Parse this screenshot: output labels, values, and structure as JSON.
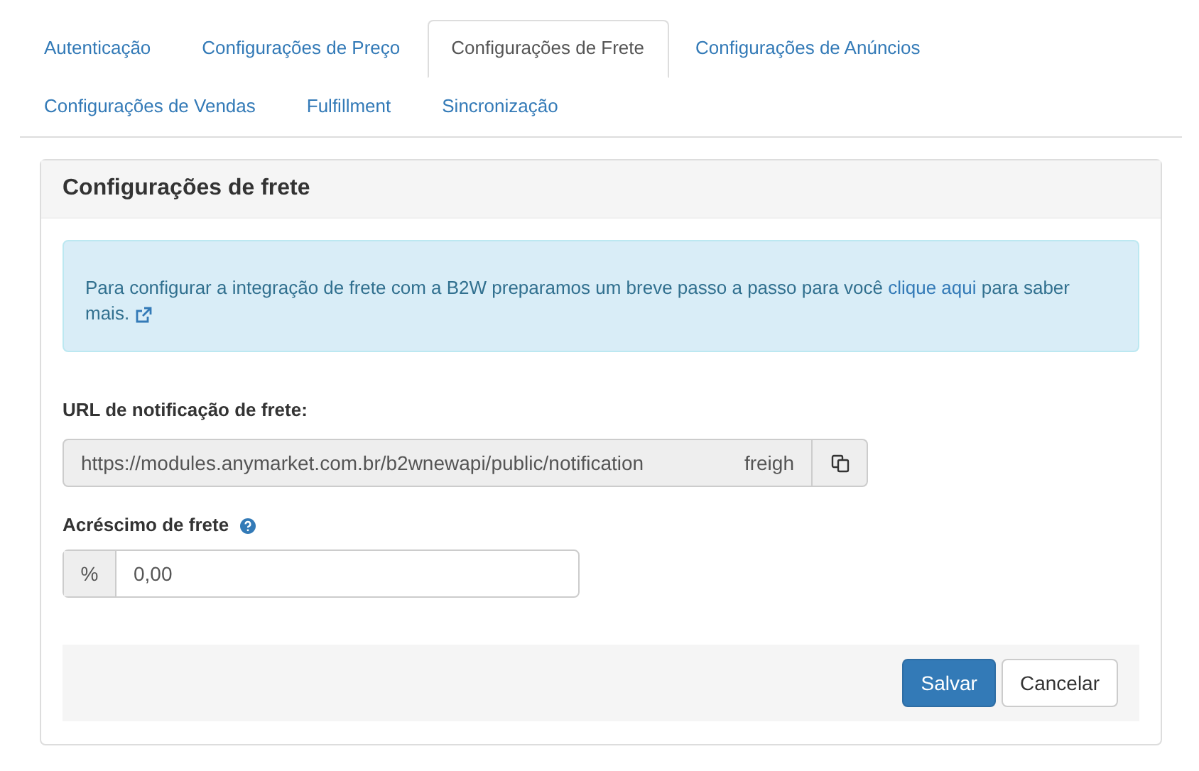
{
  "tabs": [
    {
      "label": "Autenticação",
      "selected": false
    },
    {
      "label": "Configurações de Preço",
      "selected": false
    },
    {
      "label": "Configurações de Frete",
      "selected": true
    },
    {
      "label": "Configurações de Anúncios",
      "selected": false
    },
    {
      "label": "Configurações de Vendas",
      "selected": false
    },
    {
      "label": "Fulfillment",
      "selected": false
    },
    {
      "label": "Sincronização",
      "selected": false
    }
  ],
  "panel": {
    "title": "Configurações de frete",
    "alert": {
      "text_before": "Para configurar a integração de frete com a B2W preparamos um breve passo a passo para você",
      "link": "clique aqui",
      "text_after": "para saber mais."
    },
    "url_field": {
      "label": "URL de notificação de frete:",
      "value": "https://modules.anymarket.com.br/b2wnewapi/public/notification",
      "value_tail": "freigh"
    },
    "surcharge_field": {
      "label": "Acréscimo de frete",
      "addon": "%",
      "value": "0,00"
    },
    "buttons": [
      {
        "label": "Salvar",
        "kind": "primary"
      },
      {
        "label": "Cancelar",
        "kind": "default"
      }
    ]
  }
}
